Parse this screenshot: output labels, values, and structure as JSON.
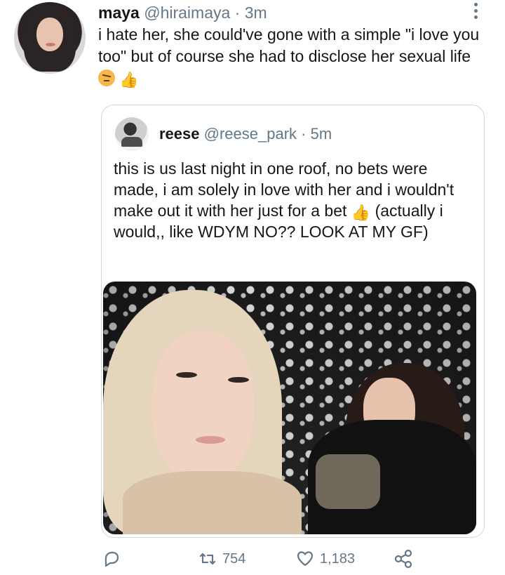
{
  "tweet": {
    "author_name": "maya",
    "handle": "@hiraimaya",
    "time": "· 3m",
    "text": "i hate her, she could've gone with a simple \"i love you too\" but of course she had to disclose her sexual life",
    "emojis": [
      "angry-face-emoji",
      "thumbs-up-emoji"
    ]
  },
  "quote": {
    "author_name": "reese",
    "handle": "@reese_park",
    "time": "· 5m",
    "text_before_emoji": "this is us last night in one roof, no bets were made, i am solely in love with her and i wouldn't make out it with her just for a bet",
    "text_after_emoji": "(actually i would,, like WDYM NO?? LOOK AT MY GF)",
    "media": "photo"
  },
  "actions": {
    "retweets": "754",
    "likes": "1,183"
  },
  "colors": {
    "text": "#14171a",
    "muted": "#657786",
    "border": "#cfd9de"
  }
}
